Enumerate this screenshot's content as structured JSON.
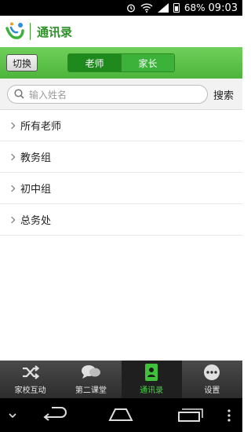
{
  "status_bar": {
    "battery": "68%",
    "time": "09:03"
  },
  "header": {
    "title": "通讯录"
  },
  "toolbar": {
    "switch_label": "切换",
    "segments": [
      {
        "label": "老师",
        "selected": true
      },
      {
        "label": "家长",
        "selected": false
      }
    ]
  },
  "search": {
    "placeholder": "输入姓名",
    "button_label": "搜索"
  },
  "groups": [
    {
      "label": "所有老师"
    },
    {
      "label": "教务组"
    },
    {
      "label": "初中组"
    },
    {
      "label": "总务处"
    }
  ],
  "tabs": [
    {
      "label": "家校互动",
      "icon": "shuffle-icon",
      "active": false
    },
    {
      "label": "第二课堂",
      "icon": "chat-bubbles-icon",
      "active": false
    },
    {
      "label": "通讯录",
      "icon": "contacts-icon",
      "active": true
    },
    {
      "label": "设置",
      "icon": "more-dots-icon",
      "active": false
    }
  ],
  "colors": {
    "brand_green": "#4db53b",
    "active_segment": "#1e8a1e",
    "active_tab_text": "#4fd04a"
  }
}
